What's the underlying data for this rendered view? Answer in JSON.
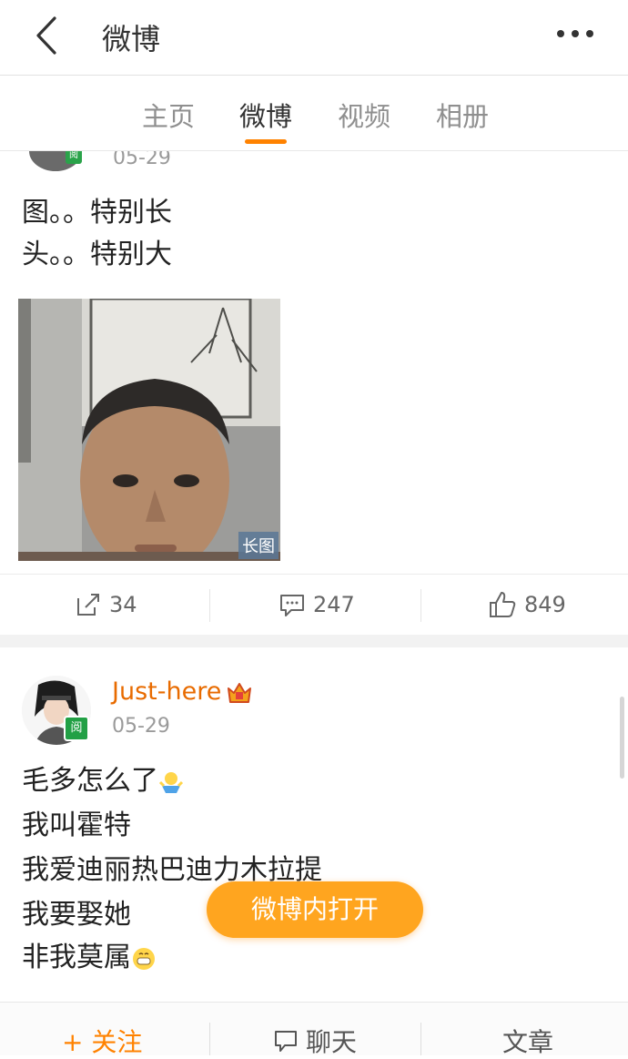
{
  "header": {
    "title": "微博"
  },
  "tabs": [
    {
      "label": "主页"
    },
    {
      "label": "微博"
    },
    {
      "label": "视频"
    },
    {
      "label": "相册"
    }
  ],
  "active_tab": "微博",
  "post1": {
    "date": "05-29",
    "lines": [
      "图。。特别长",
      "头。。特别大"
    ],
    "image_badge": "长图",
    "reposts": "34",
    "comments": "247",
    "likes": "849"
  },
  "post2": {
    "username": "Just-here",
    "date": "05-29",
    "lines": [
      "毛多怎么了",
      "我叫霍特",
      "我爱迪丽热巴迪力木拉提",
      "我要娶她",
      "非我莫属"
    ]
  },
  "open_in_app": "微博内打开",
  "bottom_bar": {
    "follow": "+ 关注",
    "chat": "聊天",
    "articles": "文章"
  },
  "colors": {
    "accent": "#ff8200",
    "button": "#ffa51f",
    "username": "#e86b00"
  }
}
